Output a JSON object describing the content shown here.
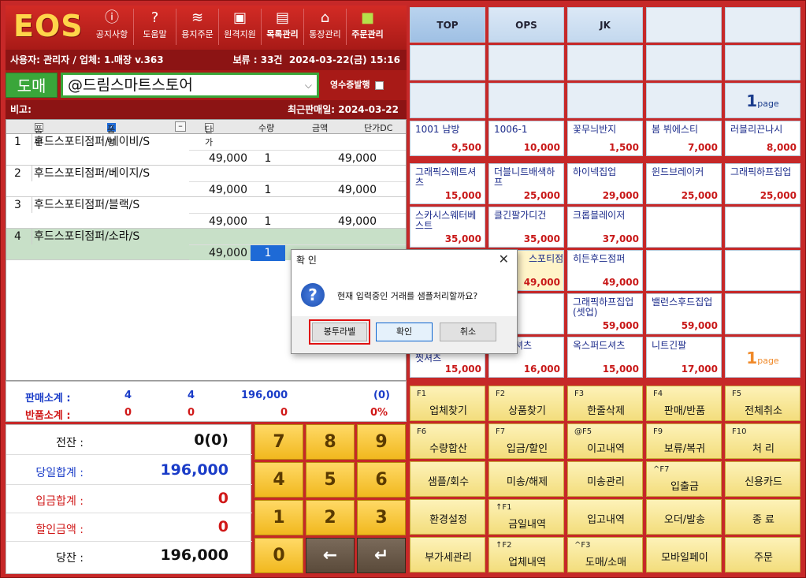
{
  "header": {
    "logo": "EOS",
    "menu": [
      {
        "label": "공지사항",
        "icon": "alert-icon"
      },
      {
        "label": "도움말",
        "icon": "help-icon"
      },
      {
        "label": "용지주문",
        "icon": "layers-icon"
      },
      {
        "label": "원격지원",
        "icon": "monitor-icon"
      },
      {
        "label": "목록관리",
        "icon": "book-icon"
      },
      {
        "label": "통장관리",
        "icon": "bank-icon"
      },
      {
        "label": "주문관리",
        "icon": "box-icon"
      }
    ]
  },
  "info": {
    "user": "사용자: 관리자 / 업체: 1.매장 v.363",
    "hold": "보류 : 33건",
    "datetime": "2024-03-22(금) 15:16"
  },
  "customer": {
    "type": "도매",
    "name": "@드림스마트스토어",
    "receipt": "영수증발행"
  },
  "memo": {
    "label": "비고:",
    "last_sale": "최근판매일: 2024-03-22"
  },
  "table": {
    "headers": [
      "품번",
      "품명",
      "단가",
      "수량",
      "금액",
      "단가DC"
    ],
    "rows": [
      {
        "no": "1",
        "name": "후드스포티점퍼/네이비/S",
        "price": "49,000",
        "qty": "1",
        "amount": "49,000"
      },
      {
        "no": "2",
        "name": "후드스포티점퍼/베이지/S",
        "price": "49,000",
        "qty": "1",
        "amount": "49,000"
      },
      {
        "no": "3",
        "name": "후드스포티점퍼/블랙/S",
        "price": "49,000",
        "qty": "1",
        "amount": "49,000"
      },
      {
        "no": "4",
        "name": "후드스포티점퍼/소라/S",
        "price": "49,000",
        "qty": "1",
        "amount": ""
      }
    ]
  },
  "subtotal": {
    "sale_label": "판매소계 :",
    "sale": [
      "4",
      "4",
      "196,000",
      "(0)"
    ],
    "return_label": "반품소계 :",
    "ret": [
      "0",
      "0",
      "0",
      "0%"
    ]
  },
  "summary": [
    {
      "k": "전잔 :",
      "v": "0(0)"
    },
    {
      "k": "당일합계 :",
      "v": "196,000"
    },
    {
      "k": "입금합계 :",
      "v": "0"
    },
    {
      "k": "할인금액 :",
      "v": "0"
    },
    {
      "k": "당잔 :",
      "v": "196,000"
    }
  ],
  "keypad": [
    "7",
    "8",
    "9",
    "4",
    "5",
    "6",
    "1",
    "2",
    "3",
    "0",
    "←",
    "↵"
  ],
  "tabs": [
    "TOP",
    "OPS",
    "JK"
  ],
  "page": {
    "num": "1",
    "word": "page"
  },
  "items": [
    {
      "name": "1001 남방",
      "price": "9,500"
    },
    {
      "name": "1006-1",
      "price": "10,000"
    },
    {
      "name": "꽃무늬반지",
      "price": "1,500"
    },
    {
      "name": "봄 뷔에스티",
      "price": "7,000"
    },
    {
      "name": "러블리끈나시",
      "price": "8,000"
    },
    {
      "name": "그래픽스웨트셔츠",
      "price": "15,000"
    },
    {
      "name": "더블니트배색하프",
      "price": "25,000"
    },
    {
      "name": "하이넥집업",
      "price": "29,000"
    },
    {
      "name": "윈드브레이커",
      "price": "25,000"
    },
    {
      "name": "그래픽하프집업",
      "price": "25,000"
    },
    {
      "name": "스카시스웨터베스트",
      "price": "35,000"
    },
    {
      "name": "클긴팔가디건",
      "price": "35,000"
    },
    {
      "name": "크롭블레이저",
      "price": "37,000"
    },
    {
      "name": "스포티점",
      "price": "49,000"
    },
    {
      "name": "히든후드점퍼",
      "price": "49,000"
    },
    {
      "name": "그래픽하프집업(셋업)",
      "price": "59,000"
    },
    {
      "name": "밸런스후드집업",
      "price": "59,000"
    },
    {
      "name": "찟셔츠",
      "price": "15,000"
    },
    {
      "name": "셔츠",
      "price": "16,000"
    },
    {
      "name": "옥스퍼드셔츠",
      "price": "15,000"
    },
    {
      "name": "니트긴팔",
      "price": "17,000"
    }
  ],
  "functions": [
    {
      "k": "F1",
      "l": "업체찾기"
    },
    {
      "k": "F2",
      "l": "상품찾기"
    },
    {
      "k": "F3",
      "l": "한줄삭제"
    },
    {
      "k": "F4",
      "l": "판매/반품"
    },
    {
      "k": "F5",
      "l": "전체취소"
    },
    {
      "k": "F6",
      "l": "수량합산"
    },
    {
      "k": "F7",
      "l": "입금/할인"
    },
    {
      "k": "@F5",
      "l": "이고내역"
    },
    {
      "k": "F9",
      "l": "보류/복귀"
    },
    {
      "k": "F10",
      "l": "처   리"
    },
    {
      "k": "",
      "l": "샘플/회수"
    },
    {
      "k": "",
      "l": "미송/해제"
    },
    {
      "k": "",
      "l": "미송관리"
    },
    {
      "k": "^F7",
      "l": "입출금"
    },
    {
      "k": "",
      "l": "신용카드"
    },
    {
      "k": "",
      "l": "환경설정"
    },
    {
      "k": "↑F1",
      "l": "금일내역"
    },
    {
      "k": "",
      "l": "입고내역"
    },
    {
      "k": "",
      "l": "오더/발송"
    },
    {
      "k": "",
      "l": "종   료"
    },
    {
      "k": "",
      "l": "부가세관리"
    },
    {
      "k": "↑F2",
      "l": "업체내역"
    },
    {
      "k": "^F3",
      "l": "도매/소매"
    },
    {
      "k": "",
      "l": "모바일페이"
    },
    {
      "k": "",
      "l": "주문"
    }
  ],
  "dialog": {
    "title": "확 인",
    "message": "현재 입력중인 거래를 샘플처리할까요?",
    "buttons": [
      "봉투라벨",
      "확인",
      "취소"
    ]
  }
}
